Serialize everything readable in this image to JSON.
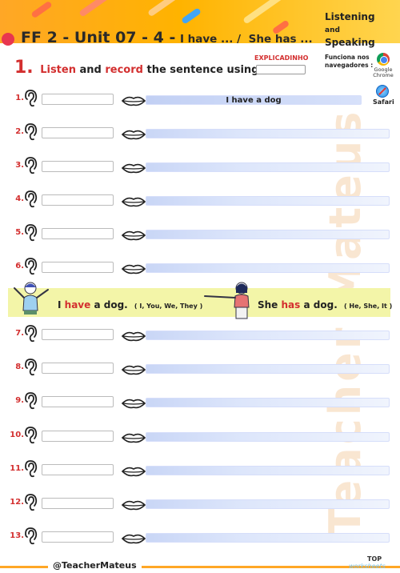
{
  "header": {
    "title_main": "FF 2 - Unit 07 - 4 -",
    "title_sub_a": "I have ... /",
    "title_sub_b": "She has ...",
    "badge_line1": "Listening",
    "badge_and": "and",
    "badge_line2": "Speaking"
  },
  "instruction": {
    "number": "1.",
    "listen": "Listen",
    "and": "and",
    "record": "record",
    "rest": "the sentence using “ I ”."
  },
  "explicadinho": {
    "label": "EXPLICADINHO",
    "value": ""
  },
  "browsers": {
    "label": "Funciona nos navegadores :",
    "chrome": "Google Chrome",
    "safari": "Safari"
  },
  "rows": [
    {
      "number": "1.",
      "answer": "I have a dog"
    },
    {
      "number": "2.",
      "answer": ""
    },
    {
      "number": "3.",
      "answer": ""
    },
    {
      "number": "4.",
      "answer": ""
    },
    {
      "number": "5.",
      "answer": ""
    },
    {
      "number": "6.",
      "answer": ""
    },
    {
      "number": "7.",
      "answer": ""
    },
    {
      "number": "8.",
      "answer": ""
    },
    {
      "number": "9.",
      "answer": ""
    },
    {
      "number": "10.",
      "answer": ""
    },
    {
      "number": "11.",
      "answer": ""
    },
    {
      "number": "12.",
      "answer": ""
    },
    {
      "number": "13.",
      "answer": ""
    }
  ],
  "example": {
    "left_pre": "I",
    "left_verb": "have",
    "left_post": "a dog.",
    "left_sub": "( I, You, We, They )",
    "right_pre": "She",
    "right_verb": "has",
    "right_post": "a dog.",
    "right_sub": "( He, She, It )"
  },
  "watermark": "Teacher Mateus",
  "footer": {
    "handle": "@TeacherMateus",
    "top": "TOP",
    "worksheets": "worksheets"
  },
  "colors": {
    "accent": "#ffa726",
    "number_red": "#d32f2f",
    "example_band": "#f3f5a8",
    "answer_bar": "#c9d6f6"
  }
}
